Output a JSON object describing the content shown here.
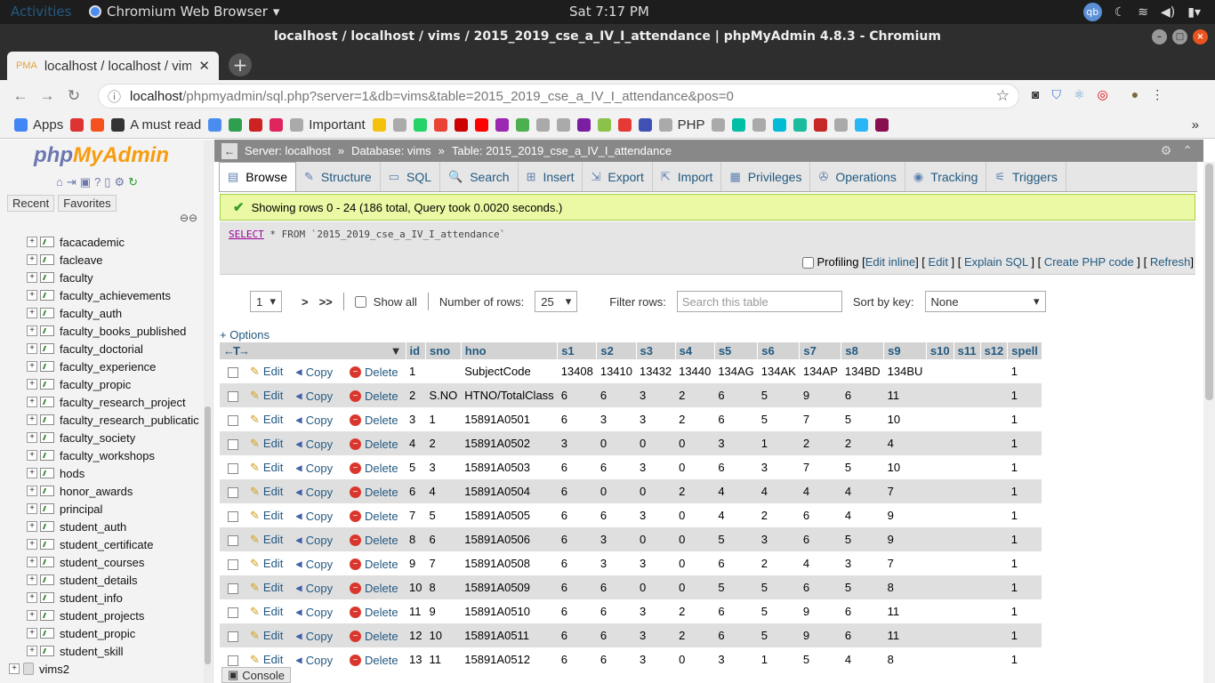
{
  "os": {
    "activities": "Activities",
    "app_name": "Chromium Web Browser",
    "clock": "Sat  7:17 PM",
    "user_badge": "qb"
  },
  "window": {
    "title": "localhost / localhost / vims / 2015_2019_cse_a_IV_I_attendance | phpMyAdmin 4.8.3 - Chromium"
  },
  "tab": {
    "label": "localhost / localhost / vim",
    "favicon": "PMA"
  },
  "omnibox": {
    "host": "localhost",
    "path": "/phpmyadmin/sql.php?server=1&db=vims&table=2015_2019_cse_a_IV_I_attendance&pos=0"
  },
  "bookmarks": [
    {
      "label": "Apps",
      "color": "#4285f4"
    },
    {
      "label": "",
      "color": "#d33"
    },
    {
      "label": "",
      "color": "#f4511e"
    },
    {
      "label": "A must read",
      "color": "#333"
    },
    {
      "label": "",
      "color": "#4a8cf0"
    },
    {
      "label": "",
      "color": "#2e9e4f"
    },
    {
      "label": "",
      "color": "#cc2222"
    },
    {
      "label": "",
      "color": "#e0245e"
    },
    {
      "label": "Important",
      "color": "#aaa"
    },
    {
      "label": "",
      "color": "#f4c20d"
    },
    {
      "label": "",
      "color": "#aaa"
    },
    {
      "label": "",
      "color": "#25d366"
    },
    {
      "label": "",
      "color": "#ea4335"
    },
    {
      "label": "",
      "color": "#c00"
    },
    {
      "label": "",
      "color": "#f00"
    },
    {
      "label": "",
      "color": "#9c27b0"
    },
    {
      "label": "",
      "color": "#4caf50"
    },
    {
      "label": "",
      "color": "#aaa"
    },
    {
      "label": "",
      "color": "#aaa"
    },
    {
      "label": "",
      "color": "#7b1fa2"
    },
    {
      "label": "",
      "color": "#8bc34a"
    },
    {
      "label": "",
      "color": "#e53935"
    },
    {
      "label": "",
      "color": "#3f51b5"
    },
    {
      "label": "PHP",
      "color": "#aaa"
    },
    {
      "label": "",
      "color": "#aaa"
    },
    {
      "label": "",
      "color": "#00bfa5"
    },
    {
      "label": "",
      "color": "#aaa"
    },
    {
      "label": "",
      "color": "#00bcd4"
    },
    {
      "label": "",
      "color": "#1abc9c"
    },
    {
      "label": "",
      "color": "#c62828"
    },
    {
      "label": "",
      "color": "#aaa"
    },
    {
      "label": "",
      "color": "#29b6f6"
    },
    {
      "label": "",
      "color": "#880e4f"
    }
  ],
  "pma": {
    "logo_php": "php",
    "logo_admin": "MyAdmin",
    "recent": "Recent",
    "favorites": "Favorites",
    "tree": [
      "facacademic",
      "facleave",
      "faculty",
      "faculty_achievements",
      "faculty_auth",
      "faculty_books_published",
      "faculty_doctorial",
      "faculty_experience",
      "faculty_propic",
      "faculty_research_project",
      "faculty_research_publicatic",
      "faculty_society",
      "faculty_workshops",
      "hods",
      "honor_awards",
      "principal",
      "student_auth",
      "student_certificate",
      "student_courses",
      "student_details",
      "student_info",
      "student_projects",
      "student_propic",
      "student_skill"
    ],
    "other_db": "vims2"
  },
  "breadcrumb": {
    "server": "Server: localhost",
    "database": "Database: vims",
    "table": "Table: 2015_2019_cse_a_IV_I_attendance"
  },
  "tabs": [
    "Browse",
    "Structure",
    "SQL",
    "Search",
    "Insert",
    "Export",
    "Import",
    "Privileges",
    "Operations",
    "Tracking",
    "Triggers"
  ],
  "message": "Showing rows 0 - 24 (186 total, Query took 0.0020 seconds.)",
  "query": {
    "select": "SELECT",
    "rest": " * FROM `2015_2019_cse_a_IV_I_attendance`"
  },
  "query_links": {
    "profiling": "Profiling",
    "edit_inline": "Edit inline",
    "edit": "Edit",
    "explain": "Explain SQL",
    "create_php": "Create PHP code",
    "refresh": "Refresh"
  },
  "nav": {
    "page": "1",
    "next": ">",
    "last": ">>",
    "show_all": "Show all",
    "rows_label": "Number of rows:",
    "rows_value": "25",
    "filter_label": "Filter rows:",
    "filter_placeholder": "Search this table",
    "sort_label": "Sort by key:",
    "sort_value": "None"
  },
  "options": "+ Options",
  "actions": {
    "edit": "Edit",
    "copy": "Copy",
    "delete": "Delete"
  },
  "columns": [
    "id",
    "sno",
    "hno",
    "s1",
    "s2",
    "s3",
    "s4",
    "s5",
    "s6",
    "s7",
    "s8",
    "s9",
    "s10",
    "s11",
    "s12",
    "spell"
  ],
  "rows": [
    [
      "1",
      "",
      "SubjectCode",
      "13408",
      "13410",
      "13432",
      "13440",
      "134AG",
      "134AK",
      "134AP",
      "134BD",
      "134BU",
      "",
      "",
      "",
      "1"
    ],
    [
      "2",
      "S.NO",
      "HTNO/TotalClass",
      "6",
      "6",
      "3",
      "2",
      "6",
      "5",
      "9",
      "6",
      "11",
      "",
      "",
      "",
      "1"
    ],
    [
      "3",
      "1",
      "15891A0501",
      "6",
      "3",
      "3",
      "2",
      "6",
      "5",
      "7",
      "5",
      "10",
      "",
      "",
      "",
      "1"
    ],
    [
      "4",
      "2",
      "15891A0502",
      "3",
      "0",
      "0",
      "0",
      "3",
      "1",
      "2",
      "2",
      "4",
      "",
      "",
      "",
      "1"
    ],
    [
      "5",
      "3",
      "15891A0503",
      "6",
      "6",
      "3",
      "0",
      "6",
      "3",
      "7",
      "5",
      "10",
      "",
      "",
      "",
      "1"
    ],
    [
      "6",
      "4",
      "15891A0504",
      "6",
      "0",
      "0",
      "2",
      "4",
      "4",
      "4",
      "4",
      "7",
      "",
      "",
      "",
      "1"
    ],
    [
      "7",
      "5",
      "15891A0505",
      "6",
      "6",
      "3",
      "0",
      "4",
      "2",
      "6",
      "4",
      "9",
      "",
      "",
      "",
      "1"
    ],
    [
      "8",
      "6",
      "15891A0506",
      "6",
      "3",
      "0",
      "0",
      "5",
      "3",
      "6",
      "5",
      "9",
      "",
      "",
      "",
      "1"
    ],
    [
      "9",
      "7",
      "15891A0508",
      "6",
      "3",
      "3",
      "0",
      "6",
      "2",
      "4",
      "3",
      "7",
      "",
      "",
      "",
      "1"
    ],
    [
      "10",
      "8",
      "15891A0509",
      "6",
      "6",
      "0",
      "0",
      "5",
      "5",
      "6",
      "5",
      "8",
      "",
      "",
      "",
      "1"
    ],
    [
      "11",
      "9",
      "15891A0510",
      "6",
      "6",
      "3",
      "2",
      "6",
      "5",
      "9",
      "6",
      "11",
      "",
      "",
      "",
      "1"
    ],
    [
      "12",
      "10",
      "15891A0511",
      "6",
      "6",
      "3",
      "2",
      "6",
      "5",
      "9",
      "6",
      "11",
      "",
      "",
      "",
      "1"
    ],
    [
      "13",
      "11",
      "15891A0512",
      "6",
      "6",
      "3",
      "0",
      "3",
      "1",
      "5",
      "4",
      "8",
      "",
      "",
      "",
      "1"
    ]
  ],
  "console": "Console"
}
